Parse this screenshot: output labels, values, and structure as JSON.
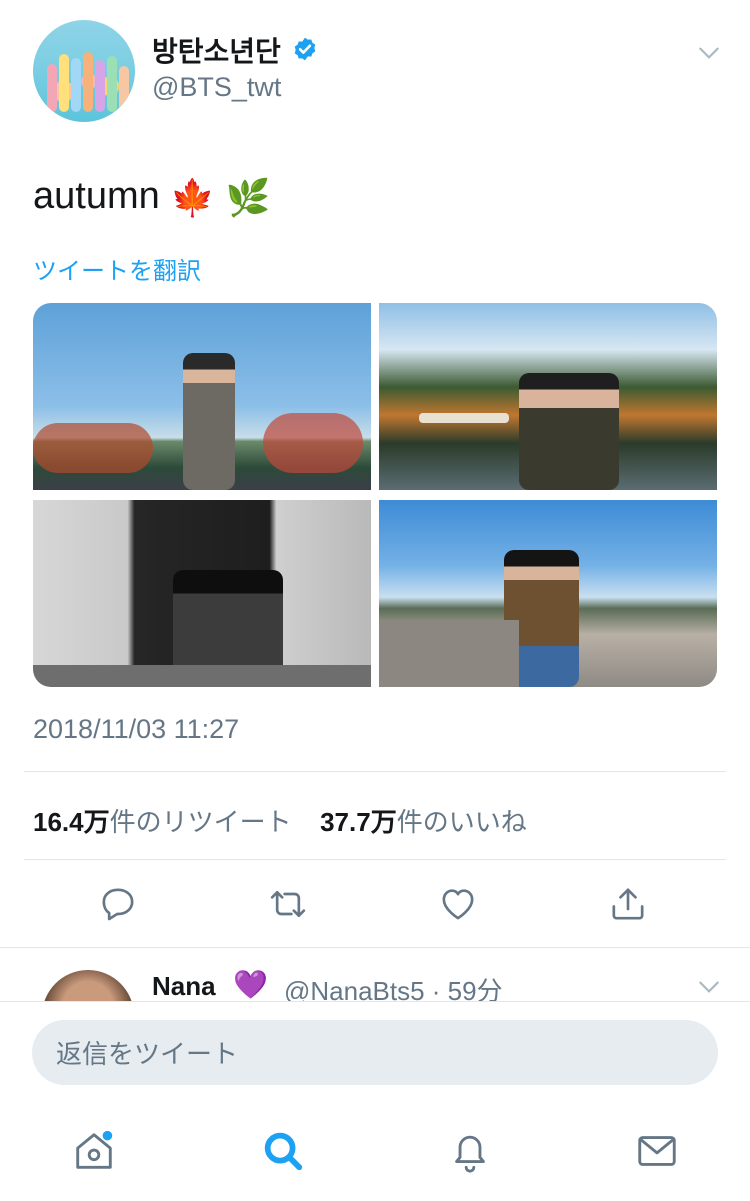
{
  "tweet": {
    "display_name": "방탄소년단",
    "handle": "@BTS_twt",
    "text": "autumn",
    "emojis": [
      "🍁",
      "🌿"
    ],
    "translate_label": "ツイートを翻訳",
    "timestamp": "2018/11/03 11:27",
    "retweets_count": "16.4万",
    "retweets_label": "件のリツイート",
    "likes_count": "37.7万",
    "likes_label": "件のいいね"
  },
  "reply_preview": {
    "name": "Nana",
    "heart": "💜",
    "handle_time": "@NanaBts5 · 59分"
  },
  "composer": {
    "placeholder": "返信をツイート"
  },
  "icons": {
    "verified": "verified-badge-icon",
    "caret": "chevron-down-icon",
    "actions": [
      "reply-icon",
      "retweet-icon",
      "like-icon",
      "share-icon"
    ],
    "tabs": [
      "home-icon",
      "search-icon",
      "notifications-icon",
      "messages-icon"
    ]
  },
  "colors": {
    "accent": "#1da1f2",
    "text": "#14171a",
    "muted": "#657786",
    "divider": "#e1e8ed"
  }
}
